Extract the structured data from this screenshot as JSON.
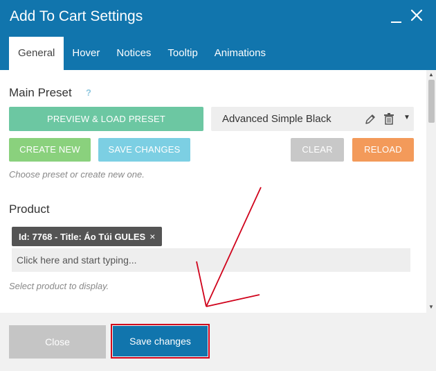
{
  "dialog": {
    "title": "Add To Cart Settings"
  },
  "tabs": [
    {
      "label": "General",
      "active": true
    },
    {
      "label": "Hover"
    },
    {
      "label": "Notices"
    },
    {
      "label": "Tooltip"
    },
    {
      "label": "Animations"
    }
  ],
  "main_preset": {
    "title": "Main Preset",
    "help": "?",
    "preview_label": "PREVIEW & LOAD PRESET",
    "selected_preset": "Advanced Simple Black",
    "create_new_label": "CREATE NEW",
    "save_changes_label": "SAVE CHANGES",
    "clear_label": "CLEAR",
    "reload_label": "RELOAD",
    "hint": "Choose preset or create new one."
  },
  "product": {
    "title": "Product",
    "selected_chip": "Id: 7768 - Title: Áo Túi GULES",
    "chip_remove": "×",
    "placeholder": "Click here and start typing...",
    "hint": "Select product to display."
  },
  "footer": {
    "close_label": "Close",
    "save_label": "Save changes"
  },
  "colors": {
    "header": "#1175ad",
    "preview_button": "#6cc7a2",
    "create_button": "#8ad17d",
    "save_preset_button": "#7ccfe3",
    "clear_button": "#c8c8c8",
    "reload_button": "#f39a5a",
    "annotation": "#d0021b"
  }
}
